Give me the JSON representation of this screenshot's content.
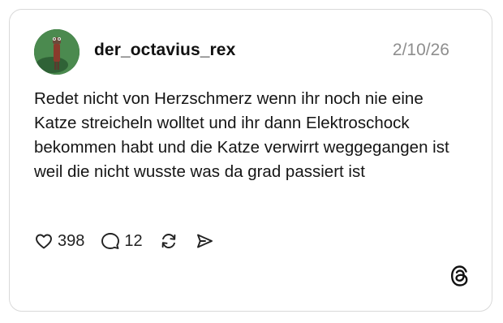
{
  "post": {
    "username": "der_octavius_rex",
    "date": "2/10/26",
    "text": "Redet nicht von Herzschmerz wenn ihr noch nie eine Katze streicheln wolltet und ihr dann Elektroschock bekommen habt und die Katze verwirrt weggegangen ist weil die nicht wusste was da grad passiert ist",
    "likes": "398",
    "replies": "12"
  },
  "icons": {
    "like": "heart-icon",
    "reply": "speech-bubble-icon",
    "repost": "repost-icon",
    "share": "send-icon",
    "brand": "threads-logo-icon"
  },
  "colors": {
    "border": "#d9d9d9",
    "muted_text": "#8e8e8e",
    "avatar_background": "#3f7a46"
  }
}
